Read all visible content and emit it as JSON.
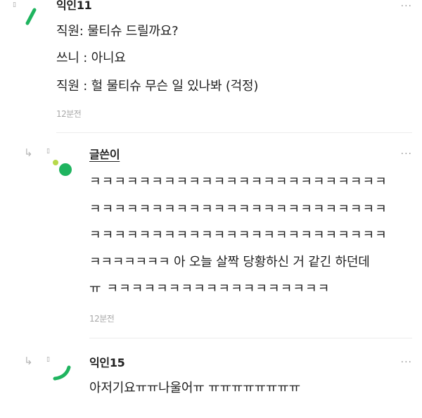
{
  "comments": [
    {
      "author": "익인11",
      "lines": [
        "직원: 물티슈 드릴까요?",
        "쓰니 : 아니요",
        "직원 : 헐 물티슈 무슨 일 있나봐 (걱정)"
      ],
      "time": "12분전",
      "avatar_color": "#1fb45f"
    },
    {
      "author": "글쓴이",
      "lines": [
        "ㅋㅋㅋㅋㅋㅋㅋㅋㅋㅋㅋㅋㅋㅋㅋㅋㅋㅋㅋㅋㅋㅋㅋㅋ",
        "ㅋㅋㅋㅋㅋㅋㅋㅋㅋㅋㅋㅋㅋㅋㅋㅋㅋㅋㅋㅋㅋㅋㅋㅋ",
        "ㅋㅋㅋㅋㅋㅋㅋㅋㅋㅋㅋㅋㅋㅋㅋㅋㅋㅋㅋㅋㅋㅋㅋㅋ",
        "ㅋㅋㅋㅋㅋㅋㅋ 아 오늘 살짝 당황하신 거 같긴 하던데",
        "ㅠ ㅋㅋㅋㅋㅋㅋㅋㅋㅋㅋㅋㅋㅋㅋㅋㅋㅋㅋ"
      ],
      "time": "12분전",
      "avatar_color": "#1fb45f",
      "avatar_dot_color": "#b7d94a"
    },
    {
      "author": "익인15",
      "lines": [
        "아저기요ㅠㅠ나울어ㅠ ㅠㅠㅠㅠㅠㅠㅠㅠ"
      ],
      "avatar_color": "#1fb45f"
    }
  ],
  "ui": {
    "more_glyph": "···",
    "reply_glyph": "↳",
    "mark_glyph": "▯"
  }
}
